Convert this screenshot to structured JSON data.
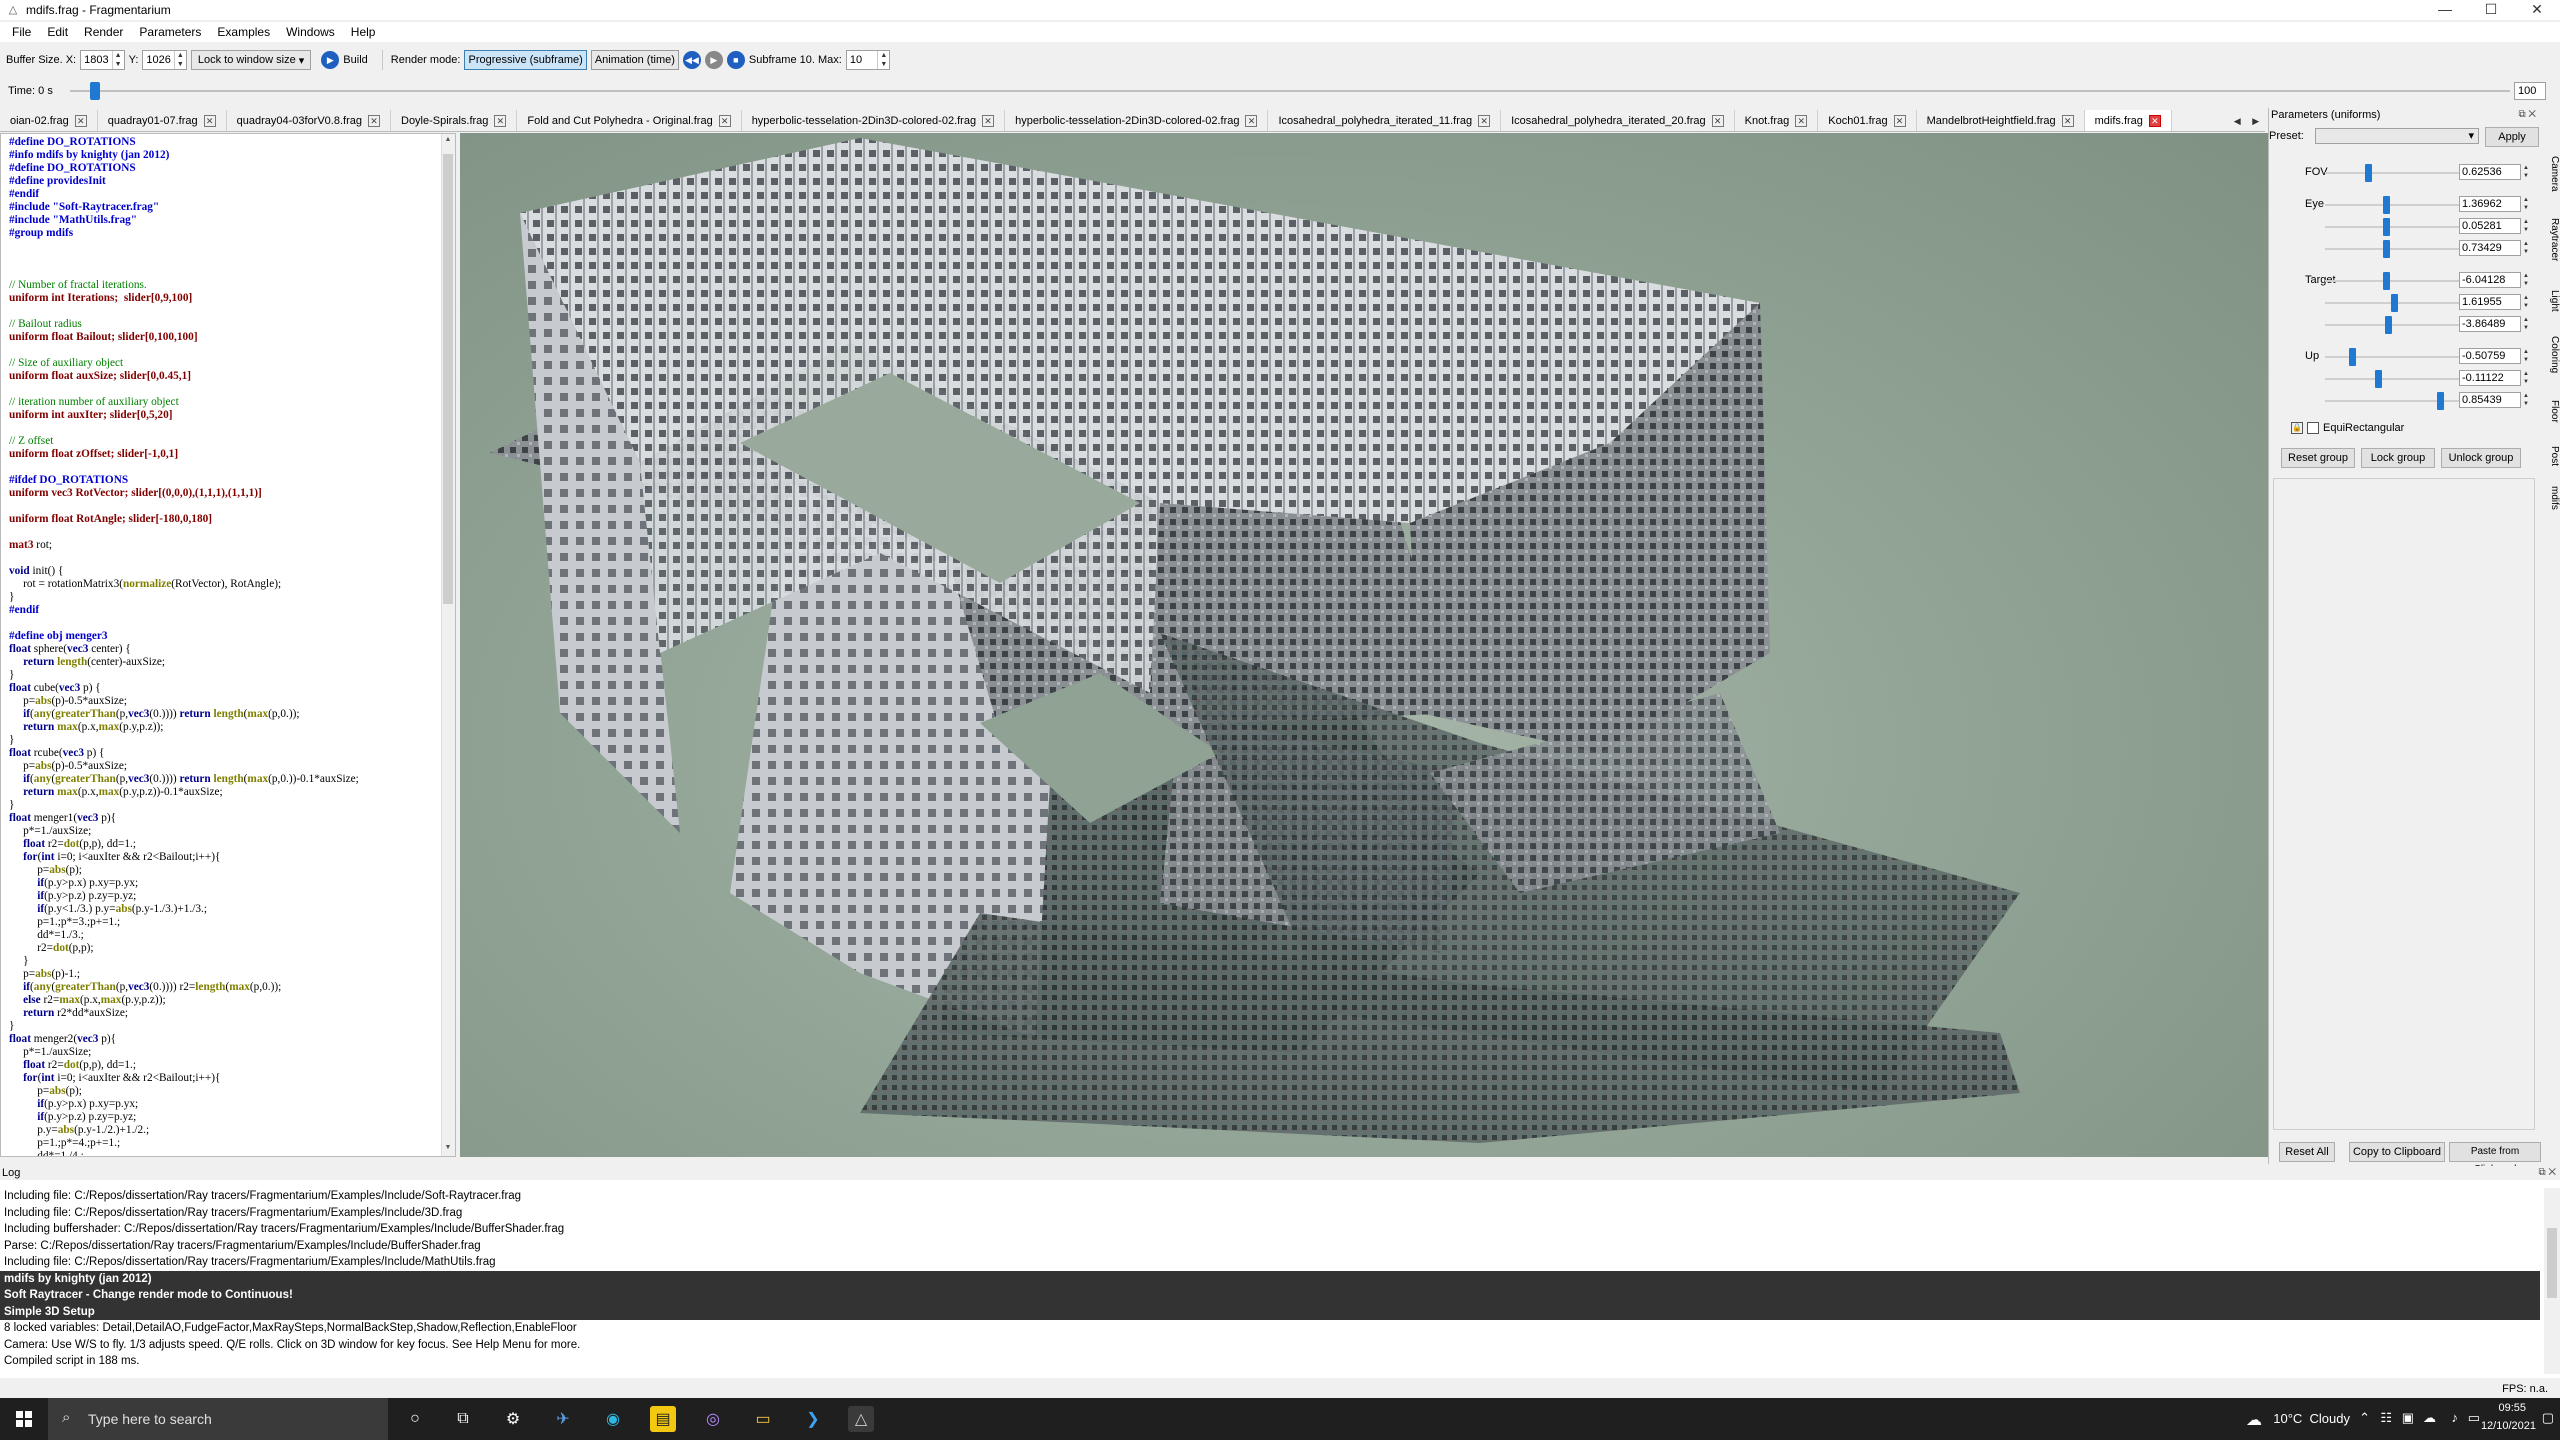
{
  "window": {
    "title": "mdifs.frag - Fragmentarium",
    "minimize": "—",
    "maximize": "☐",
    "close": "✕"
  },
  "menu": [
    "File",
    "Edit",
    "Render",
    "Parameters",
    "Examples",
    "Windows",
    "Help"
  ],
  "toolbar": {
    "buffer_label": "Buffer Size. X:",
    "buffer_x": "1803",
    "y_label": "Y:",
    "buffer_y": "1026",
    "lock_option": "Lock to window size",
    "build_label": "Build",
    "render_mode_label": "Render mode:",
    "mode_progressive": "Progressive (subframe)",
    "mode_animation": "Animation (time)",
    "subframe_label": "Subframe 10. Max:",
    "subframe_max": "10"
  },
  "timeline": {
    "time_label": "Time: 0 s",
    "end_value": "100"
  },
  "tabs": [
    "oian-02.frag",
    "quadray01-07.frag",
    "quadray04-03forV0.8.frag",
    "Doyle-Spirals.frag",
    "Fold and Cut Polyhedra - Original.frag",
    "hyperbolic-tesselation-2Din3D-colored-02.frag",
    "hyperbolic-tesselation-2Din3D-colored-02.frag",
    "Icosahedral_polyhedra_iterated_11.frag",
    "Icosahedral_polyhedra_iterated_20.frag",
    "Knot.frag",
    "Koch01.frag",
    "MandelbrotHeightfield.frag",
    "mdifs.frag"
  ],
  "params": {
    "title": "Parameters (uniforms)",
    "preset_label": "Preset:",
    "apply": "Apply",
    "fov_label": "FOV",
    "fov": "0.62536",
    "eye_label": "Eye",
    "eye": [
      "1.36962",
      "0.05281",
      "0.73429"
    ],
    "target_label": "Target",
    "target": [
      "-6.04128",
      "1.61955",
      "-3.86489"
    ],
    "up_label": "Up",
    "up": [
      "-0.50759",
      "-0.11122",
      "0.85439"
    ],
    "equirect_label": "EquiRectangular",
    "reset_group": "Reset group",
    "lock_group": "Lock group",
    "unlock_group": "Unlock group",
    "reset_all": "Reset All",
    "copy_clipboard": "Copy to Clipboard",
    "paste_clipboard": "Paste from Clipboard",
    "vtabs": [
      "Camera",
      "Raytracer",
      "Light",
      "Coloring",
      "Floor",
      "Post",
      "mdifs"
    ]
  },
  "log": {
    "title": "Log",
    "lines": [
      {
        "text": "Including file: C:/Repos/dissertation/Ray tracers/Fragmentarium/Examples/Include/Soft-Raytracer.frag",
        "hl": false
      },
      {
        "text": "Including file: C:/Repos/dissertation/Ray tracers/Fragmentarium/Examples/Include/3D.frag",
        "hl": false
      },
      {
        "text": "Including buffershader: C:/Repos/dissertation/Ray tracers/Fragmentarium/Examples/Include/BufferShader.frag",
        "hl": false
      },
      {
        "text": "Parse: C:/Repos/dissertation/Ray tracers/Fragmentarium/Examples/Include/BufferShader.frag",
        "hl": false
      },
      {
        "text": "Including file: C:/Repos/dissertation/Ray tracers/Fragmentarium/Examples/Include/MathUtils.frag",
        "hl": false
      },
      {
        "text": "mdifs by knighty (jan 2012)",
        "hl": true
      },
      {
        "text": "Soft Raytracer - Change render mode to Continuous!",
        "hl": true
      },
      {
        "text": "Simple 3D Setup",
        "hl": true
      },
      {
        "text": "8 locked variables: Detail,DetailAO,FudgeFactor,MaxRaySteps,NormalBackStep,Shadow,Reflection,EnableFloor",
        "hl": false
      },
      {
        "text": "Camera: Use W/S to fly. 1/3 adjusts speed. Q/E rolls. Click on 3D window for key focus. See Help Menu for more.",
        "hl": false
      },
      {
        "text": "Compiled script in 188 ms.",
        "hl": false
      }
    ]
  },
  "status": {
    "fps": "FPS: n.a."
  },
  "taskbar": {
    "search_placeholder": "Type here to search",
    "weather": "10°C  Cloudy",
    "time": "09:55",
    "date": "12/10/2021"
  }
}
